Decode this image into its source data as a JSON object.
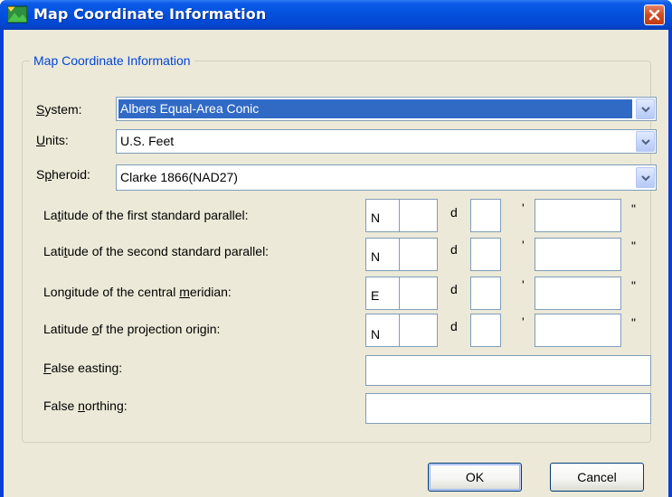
{
  "window": {
    "title": "Map Coordinate Information"
  },
  "group": {
    "legend": "Map Coordinate Information"
  },
  "combos": [
    {
      "label_pre": "",
      "label_u": "S",
      "label_post": "ystem:",
      "value": "Albers Equal-Area Conic",
      "selected": true
    },
    {
      "label_pre": "",
      "label_u": "U",
      "label_post": "nits:",
      "value": "U.S. Feet",
      "selected": false
    },
    {
      "label_pre": "S",
      "label_u": "p",
      "label_post": "heroid:",
      "value": "Clarke 1866(NAD27)",
      "selected": false
    }
  ],
  "coords": [
    {
      "label_pre": "La",
      "label_u": "t",
      "label_post": "itude of the first standard parallel:",
      "hemisphere": "N"
    },
    {
      "label_pre": "Lati",
      "label_u": "t",
      "label_post": "ude of the second standard parallel:",
      "hemisphere": "N"
    },
    {
      "label_pre": "Longitude of the central ",
      "label_u": "m",
      "label_post": "eridian:",
      "hemisphere": "E"
    },
    {
      "label_pre": "Latitude ",
      "label_u": "o",
      "label_post": "f the projection origin:",
      "hemisphere": "N"
    }
  ],
  "units": {
    "degrees": "d",
    "minutes": "'",
    "seconds": "\""
  },
  "false_easting": {
    "label_pre": "",
    "label_u": "F",
    "label_post": "alse easting:",
    "value": ""
  },
  "false_northing": {
    "label_pre": "False ",
    "label_u": "n",
    "label_post": "orthing:",
    "value": ""
  },
  "buttons": {
    "ok": "OK",
    "cancel": "Cancel"
  },
  "colors": {
    "title_bar": "#0451de",
    "legend_text": "#0046d5",
    "selection": "#316ac5",
    "dialog_bg": "#ece9d8"
  }
}
